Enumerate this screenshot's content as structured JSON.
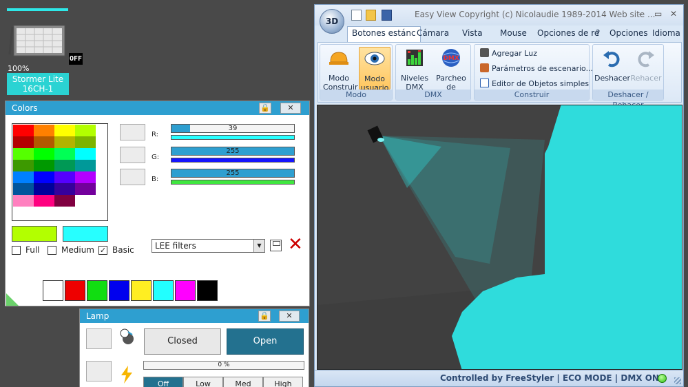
{
  "fixture": {
    "percent": "100%",
    "off_badge": "OFF",
    "name_line1": "Stormer Lite",
    "name_line2": "16CH-1"
  },
  "colors_panel": {
    "title": "Colors",
    "palette": [
      "#ff0000",
      "#ff8000",
      "#ffff00",
      "#b3ff00",
      "#b30000",
      "#b35a00",
      "#b3b300",
      "#7db300",
      "#55ff00",
      "#00ff00",
      "#00ff55",
      "#00ffff",
      "#3d9900",
      "#009900",
      "#009955",
      "#009999",
      "#0080ff",
      "#0000ff",
      "#5500ff",
      "#b300ff",
      "#00559c",
      "#00009c",
      "#36009c",
      "#73009c",
      "#ff80bf",
      "#ff0080",
      "#800040",
      "#ffffff"
    ],
    "selected_colors": [
      "#b3ff00",
      "#27ffff"
    ],
    "checkboxes": [
      {
        "label": "Full",
        "checked": false
      },
      {
        "label": "Medium",
        "checked": false
      },
      {
        "label": "Basic",
        "checked": true
      }
    ],
    "channels": [
      {
        "label": "R:",
        "value": "39",
        "fraction": 0.15,
        "thin_color": "#27ffff"
      },
      {
        "label": "G:",
        "value": "255",
        "fraction": 1.0,
        "thin_color": "#1515ff"
      },
      {
        "label": "B:",
        "value": "255",
        "fraction": 1.0,
        "thin_color": "#3fe63f"
      }
    ],
    "filter_select": "LEE filters",
    "quick_swatches": [
      "#ffffff",
      "#ee0000",
      "#11dd11",
      "#0000ee",
      "#ffee22",
      "#22ffff",
      "#ff00ff",
      "#000000"
    ]
  },
  "lamp_panel": {
    "title": "Lamp",
    "closed_label": "Closed",
    "open_label": "Open",
    "progress_label": "0 %",
    "progress_fraction": 0,
    "tabs": [
      "Off",
      "Low",
      "Med",
      "High"
    ]
  },
  "app": {
    "logo": "3D",
    "title": "Easy View   Copyright (c) Nicolaudie 1989-2014   Web site ...",
    "ribbon_tabs": [
      "Botones estánc",
      "Cámara",
      "Vista",
      "Mouse",
      "Opciones de re"
    ],
    "ribbon_right": [
      "?",
      "Opciones",
      "Idioma"
    ],
    "groups": {
      "modo": {
        "label": "Modo",
        "construir": "Modo Construir",
        "usuario": "Modo usuario"
      },
      "dmx": {
        "label": "DMX",
        "niveles": "Niveles DMX",
        "parcheo": "Parcheo de Universos",
        "dmx_icon_text": "DMX"
      },
      "construir": {
        "label": "Construir",
        "agregar": "Agregar Luz",
        "parametros": "Parámetros de escenario...",
        "editor": "Editor de Objetos simples"
      },
      "deshacer": {
        "label": "Deshacer / Rehacer",
        "deshacer": "Deshacer",
        "rehacer": "Rehacer"
      }
    },
    "status": "Controlled by FreeStyler   |   ECO MODE   |   DMX ON",
    "beam_color": "#2fdcdc"
  }
}
